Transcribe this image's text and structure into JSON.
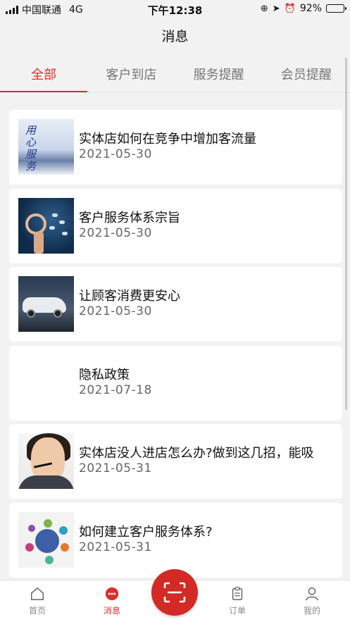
{
  "status_bar": {
    "carrier": "中国联通",
    "network": "4G",
    "time": "下午12:38",
    "battery": "92%",
    "battery_level": 0.92
  },
  "header": {
    "title": "消息"
  },
  "tabs": [
    {
      "label": "全部",
      "active": true
    },
    {
      "label": "客户到店",
      "active": false
    },
    {
      "label": "服务提醒",
      "active": false
    },
    {
      "label": "会员提醒",
      "active": false
    }
  ],
  "messages": [
    {
      "title": "实体店如何在竞争中增加客流量",
      "date": "2021-05-30",
      "thumbnail": "service-calligraphy-image",
      "thumb_text": "用心服务"
    },
    {
      "title": "客户服务体系宗旨",
      "date": "2021-05-30",
      "thumbnail": "ok-hand-image"
    },
    {
      "title": "让顾客消费更安心",
      "date": "2021-05-30",
      "thumbnail": "white-car-image"
    },
    {
      "title": "隐私政策",
      "date": "2021-07-18",
      "thumbnail": ""
    },
    {
      "title": "实体店没人进店怎么办?做到这几招，能吸",
      "date": "2021-05-31",
      "thumbnail": "customer-service-agent-image"
    },
    {
      "title": "如何建立客户服务体系?",
      "date": "2021-05-31",
      "thumbnail": "bubble-diagram-image"
    }
  ],
  "tabbar": {
    "home": "首页",
    "messages": "消息",
    "scan": "scan-icon",
    "orders": "订单",
    "mine": "我的"
  },
  "colors": {
    "accent": "#d9302a",
    "background": "#f2f2f2"
  }
}
